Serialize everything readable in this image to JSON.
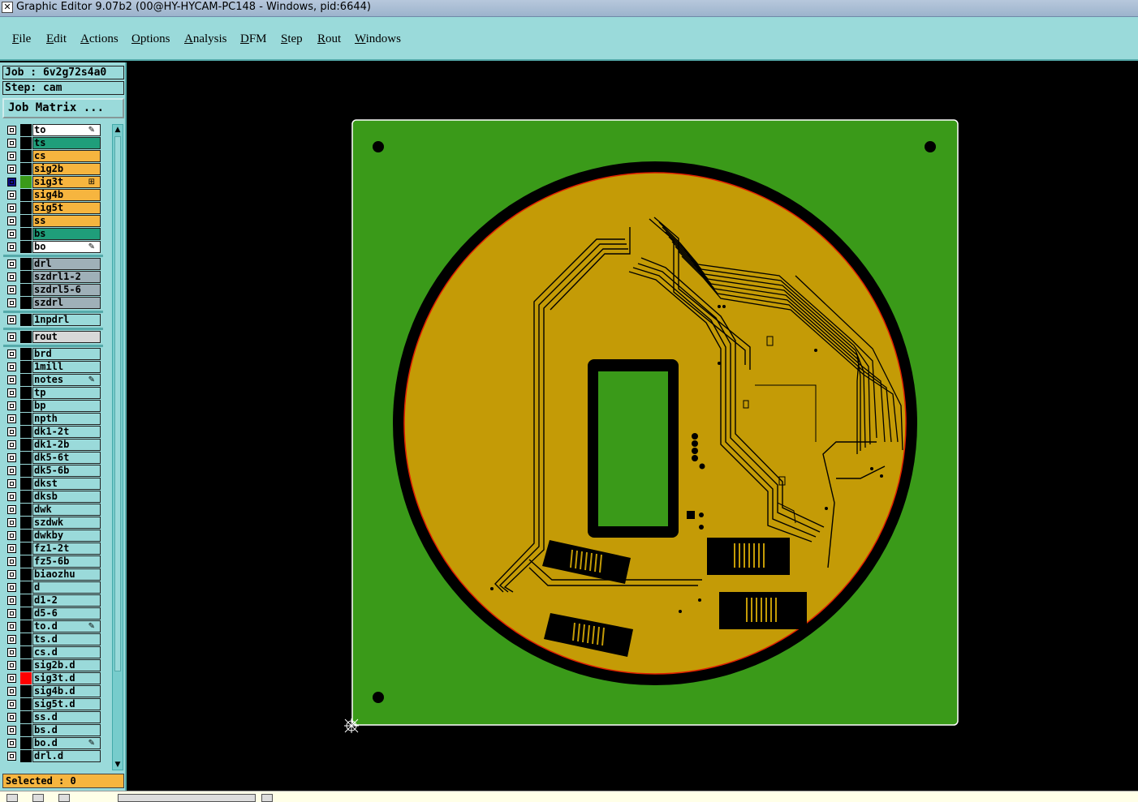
{
  "window": {
    "title": "Graphic Editor 9.07b2 (00@HY-HYCAM-PC148 - Windows, pid:6644)",
    "icon": "app-icon"
  },
  "menu": [
    "File",
    "Edit",
    "Actions",
    "Options",
    "Analysis",
    "DFM",
    "Step",
    "Rout",
    "Windows"
  ],
  "job": {
    "job_label": "Job : 6v2g72s4a0",
    "step_label": "Step: cam",
    "matrix_button": "Job Matrix ..."
  },
  "layers": [
    {
      "name": "to",
      "color": "#ffffff",
      "mark": "pencil"
    },
    {
      "name": "ts",
      "color": "#1f9e7a"
    },
    {
      "name": "cs",
      "color": "#f6b53f"
    },
    {
      "name": "sig2b",
      "color": "#f6b53f"
    },
    {
      "name": "sig3t",
      "color": "#f6b53f",
      "active": true
    },
    {
      "name": "sig4b",
      "color": "#f6b53f"
    },
    {
      "name": "sig5t",
      "color": "#f6b53f"
    },
    {
      "name": "ss",
      "color": "#f6b53f"
    },
    {
      "name": "bs",
      "color": "#1f9e7a"
    },
    {
      "name": "bo",
      "color": "#ffffff",
      "mark": "pencil"
    },
    {
      "name": "drl",
      "color": "#9fb0b8"
    },
    {
      "name": "szdrl1-2",
      "color": "#9fb0b8"
    },
    {
      "name": "szdrl5-6",
      "color": "#9fb0b8"
    },
    {
      "name": "szdrl",
      "color": "#9fb0b8"
    },
    {
      "name": "1npdrl",
      "color": "#9adada"
    },
    {
      "name": "rout",
      "color": "#d8d8d8"
    },
    {
      "name": "brd",
      "color": "#9adada"
    },
    {
      "name": "1mill",
      "color": "#9adada"
    },
    {
      "name": "notes",
      "color": "#9adada",
      "mark": "pencil"
    },
    {
      "name": "tp",
      "color": "#9adada"
    },
    {
      "name": "bp",
      "color": "#9adada"
    },
    {
      "name": "npth",
      "color": "#9adada"
    },
    {
      "name": "dk1-2t",
      "color": "#9adada"
    },
    {
      "name": "dk1-2b",
      "color": "#9adada"
    },
    {
      "name": "dk5-6t",
      "color": "#9adada"
    },
    {
      "name": "dk5-6b",
      "color": "#9adada"
    },
    {
      "name": "dkst",
      "color": "#9adada"
    },
    {
      "name": "dksb",
      "color": "#9adada"
    },
    {
      "name": "dwk",
      "color": "#9adada"
    },
    {
      "name": "szdwk",
      "color": "#9adada"
    },
    {
      "name": "dwkby",
      "color": "#9adada"
    },
    {
      "name": "fz1-2t",
      "color": "#9adada"
    },
    {
      "name": "fz5-6b",
      "color": "#9adada"
    },
    {
      "name": "biaozhu",
      "color": "#9adada"
    },
    {
      "name": "d",
      "color": "#9adada"
    },
    {
      "name": "d1-2",
      "color": "#9adada"
    },
    {
      "name": "d5-6",
      "color": "#9adada"
    },
    {
      "name": "to.d",
      "color": "#9adada",
      "mark": "pencil"
    },
    {
      "name": "ts.d",
      "color": "#9adada"
    },
    {
      "name": "cs.d",
      "color": "#9adada"
    },
    {
      "name": "sig2b.d",
      "color": "#9adada"
    },
    {
      "name": "sig3t.d",
      "color": "#9adada",
      "swatch": "#ff0000"
    },
    {
      "name": "sig4b.d",
      "color": "#9adada"
    },
    {
      "name": "sig5t.d",
      "color": "#9adada"
    },
    {
      "name": "ss.d",
      "color": "#9adada"
    },
    {
      "name": "bs.d",
      "color": "#9adada"
    },
    {
      "name": "bo.d",
      "color": "#9adada",
      "mark": "pencil"
    },
    {
      "name": "drl.d",
      "color": "#9adada"
    }
  ],
  "status": {
    "selected": "Selected : 0"
  },
  "colors": {
    "board": "#3a9a19",
    "copper": "#c49b06",
    "ring": "#000000",
    "outline": "#ffffff",
    "edge": "#e02000"
  }
}
